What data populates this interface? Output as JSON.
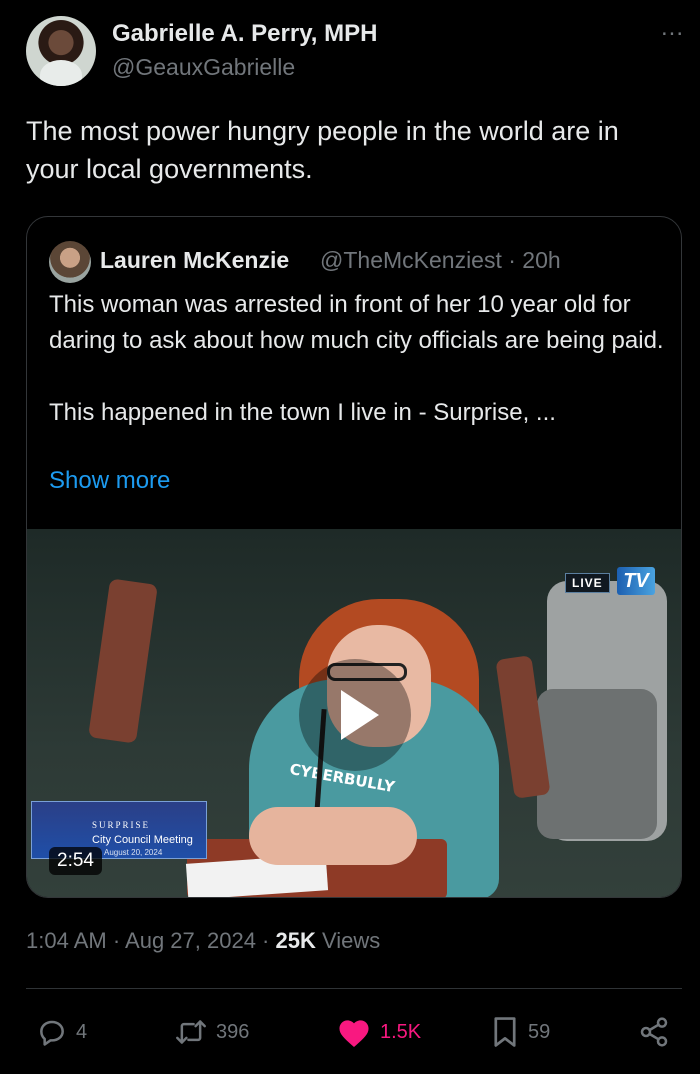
{
  "author": {
    "name": "Gabrielle A. Perry, MPH",
    "handle": "@GeauxGabrielle",
    "more_label": "..."
  },
  "tweet": {
    "text": "The most power hungry people in the world are in your local governments."
  },
  "quote": {
    "name": "Lauren McKenzie",
    "handle_meta": "@TheMcKenziest · 20h",
    "text": "This woman was arrested in front of her 10 year old for daring to ask about how much city officials are being paid.\n\nThis happened in the town I live in - Surprise, ...",
    "show_more": "Show more",
    "video": {
      "duration": "2:54",
      "live_label": "LIVE",
      "channel_logo": "TV",
      "lower_third_org": "SURPRISE",
      "lower_third_title": "City Council Meeting",
      "lower_third_date": "August 20, 2024",
      "shirt_text": "CYBERBULLY"
    }
  },
  "meta": {
    "time": "1:04 AM · Aug 27, 2024 · ",
    "views_count": "25K",
    "views_label": " Views"
  },
  "actions": {
    "replies": "4",
    "reposts": "396",
    "likes": "1.5K",
    "bookmarks": "59"
  },
  "colors": {
    "background": "#000000",
    "text": "#e7e9ea",
    "secondary": "#71767b",
    "link": "#1d9bf0",
    "like": "#f91880"
  },
  "icons": {
    "reply": "reply-icon",
    "repost": "repost-icon",
    "like": "heart-icon",
    "bookmark": "bookmark-icon",
    "share": "share-icon"
  }
}
